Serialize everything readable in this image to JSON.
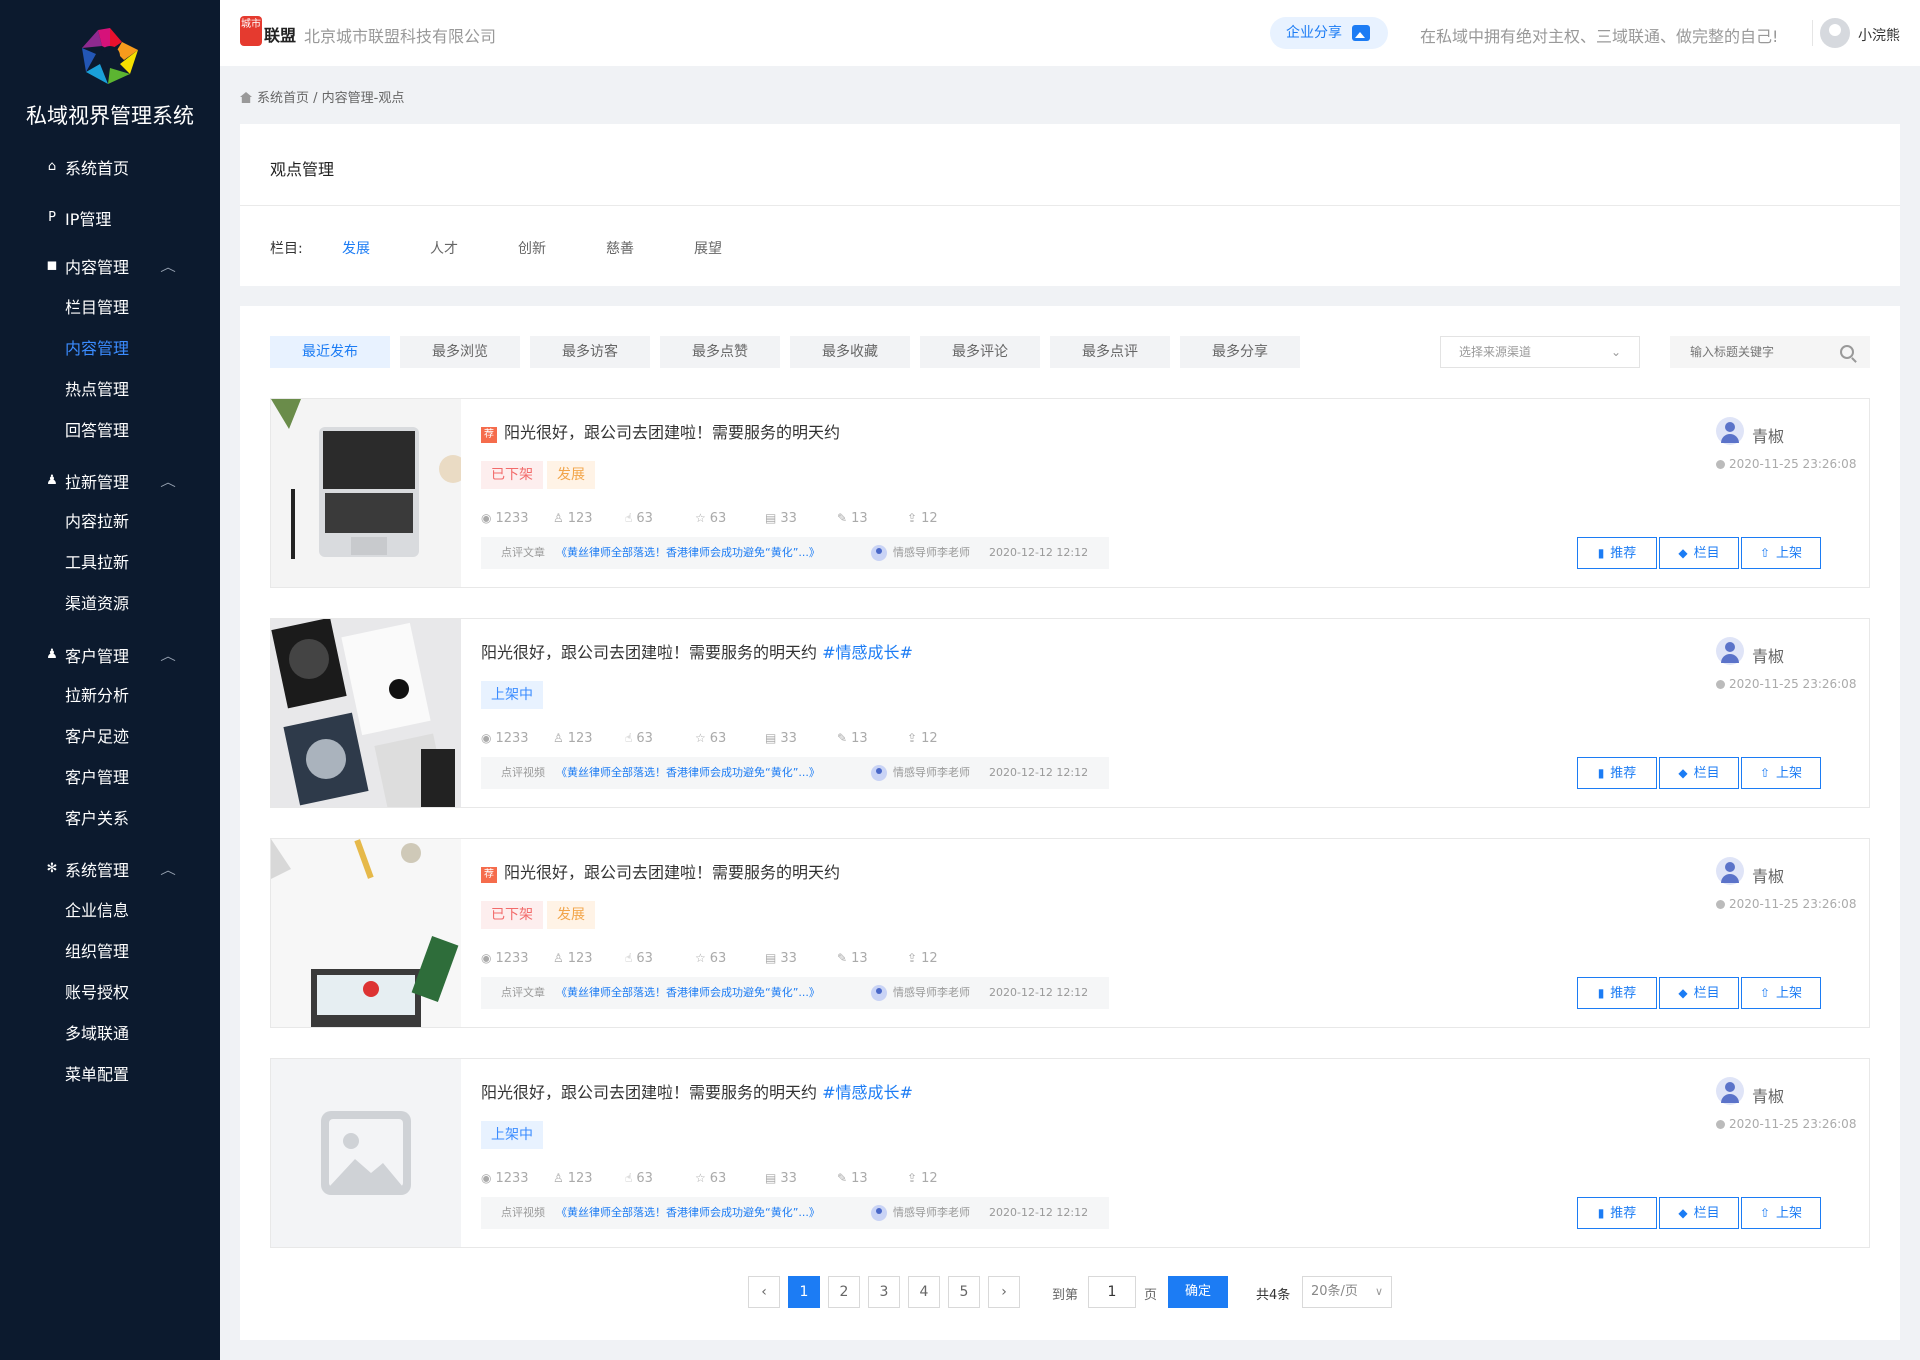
{
  "sidebar": {
    "title": "私域视界管理系统",
    "groups": [
      {
        "label": "系统首页",
        "icon": "home-icon",
        "expandable": false,
        "children": []
      },
      {
        "label": "IP管理",
        "icon": "ip-icon",
        "expandable": false,
        "children": []
      },
      {
        "label": "内容管理",
        "icon": "box-icon",
        "expandable": true,
        "children": [
          "栏目管理",
          "内容管理",
          "热点管理",
          "回答管理"
        ]
      },
      {
        "label": "拉新管理",
        "icon": "user-add-icon",
        "expandable": true,
        "children": [
          "内容拉新",
          "工具拉新",
          "渠道资源"
        ]
      },
      {
        "label": "客户管理",
        "icon": "users-icon",
        "expandable": true,
        "children": [
          "拉新分析",
          "客户足迹",
          "客户管理",
          "客户关系"
        ]
      },
      {
        "label": "系统管理",
        "icon": "gear-icon",
        "expandable": true,
        "children": [
          "企业信息",
          "组织管理",
          "账号授权",
          "多域联通",
          "菜单配置"
        ]
      }
    ],
    "active_sub": "内容管理"
  },
  "topbar": {
    "brand_mark": "城市",
    "brand": "联盟",
    "company": "北京城市联盟科技有限公司",
    "share_label": "企业分享",
    "slogan": "在私域中拥有绝对主权、三域联通、做完整的自己!",
    "user": "小浣熊"
  },
  "breadcrumb": "系统首页 / 内容管理-观点",
  "opinion": {
    "title": "观点管理",
    "column_label": "栏目:",
    "columns": [
      "发展",
      "人才",
      "创新",
      "慈善",
      "展望"
    ],
    "active_column": "发展"
  },
  "sort_tabs": [
    "最近发布",
    "最多浏览",
    "最多访客",
    "最多点赞",
    "最多收藏",
    "最多评论",
    "最多点评",
    "最多分享"
  ],
  "active_sort": "最近发布",
  "source_select": {
    "placeholder": "选择来源渠道"
  },
  "search": {
    "placeholder": "输入标题关键字"
  },
  "cards": [
    {
      "recommended": true,
      "title": "阳光很好，跟公司去团建啦！需要服务的明天约",
      "hashtag": "",
      "status": "已下架",
      "status_type": "off",
      "category": "发展",
      "stats": {
        "views": "1233",
        "visitors": "123",
        "likes": "63",
        "favorites": "63",
        "comments": "33",
        "reviews": "13",
        "shares": "12"
      },
      "comment_type": "点评文章",
      "comment_link": "《黄丝律师全部落选！香港律师会成功避免“黄化”...》",
      "comment_author": "情感导师李老师",
      "comment_date": "2020-12-12 12:12",
      "author": "青椒",
      "time": "2020-11-25 23:26:08",
      "image": "laptop"
    },
    {
      "recommended": false,
      "title": "阳光很好，跟公司去团建啦！需要服务的明天约 ",
      "hashtag": "#情感成长#",
      "status": "上架中",
      "status_type": "on",
      "category": "",
      "stats": {
        "views": "1233",
        "visitors": "123",
        "likes": "63",
        "favorites": "63",
        "comments": "33",
        "reviews": "13",
        "shares": "12"
      },
      "comment_type": "点评视频",
      "comment_link": "《黄丝律师全部落选！香港律师会成功避免“黄化”...》",
      "comment_author": "情感导师李老师",
      "comment_date": "2020-12-12 12:12",
      "author": "青椒",
      "time": "2020-11-25 23:26:08",
      "image": "cards"
    },
    {
      "recommended": true,
      "title": "阳光很好，跟公司去团建啦！需要服务的明天约",
      "hashtag": "",
      "status": "已下架",
      "status_type": "off",
      "category": "发展",
      "stats": {
        "views": "1233",
        "visitors": "123",
        "likes": "63",
        "favorites": "63",
        "comments": "33",
        "reviews": "13",
        "shares": "12"
      },
      "comment_type": "点评文章",
      "comment_link": "《黄丝律师全部落选！香港律师会成功避免“黄化”...》",
      "comment_author": "情感导师李老师",
      "comment_date": "2020-12-12 12:12",
      "author": "青椒",
      "time": "2020-11-25 23:26:08",
      "image": "desk"
    },
    {
      "recommended": false,
      "title": "阳光很好，跟公司去团建啦！需要服务的明天约 ",
      "hashtag": "#情感成长#",
      "status": "上架中",
      "status_type": "on",
      "category": "",
      "stats": {
        "views": "1233",
        "visitors": "123",
        "likes": "63",
        "favorites": "63",
        "comments": "33",
        "reviews": "13",
        "shares": "12"
      },
      "comment_type": "点评视频",
      "comment_link": "《黄丝律师全部落选！香港律师会成功避免“黄化”...》",
      "comment_author": "情感导师李老师",
      "comment_date": "2020-12-12 12:12",
      "author": "青椒",
      "time": "2020-11-25 23:26:08",
      "image": "placeholder"
    }
  ],
  "card_actions": [
    "推荐",
    "栏目",
    "上架"
  ],
  "pagination": {
    "pages": [
      "1",
      "2",
      "3",
      "4",
      "5"
    ],
    "current": "1",
    "goto_label": "到第",
    "goto_value": "1",
    "page_unit": "页",
    "confirm": "确定",
    "total": "共4条",
    "page_size": "20条/页"
  },
  "colors": {
    "sidebar_bg": "#0c1a2e",
    "accent": "#1c7cf4",
    "offline": "#f26b6b",
    "category": "#f2a54a"
  }
}
